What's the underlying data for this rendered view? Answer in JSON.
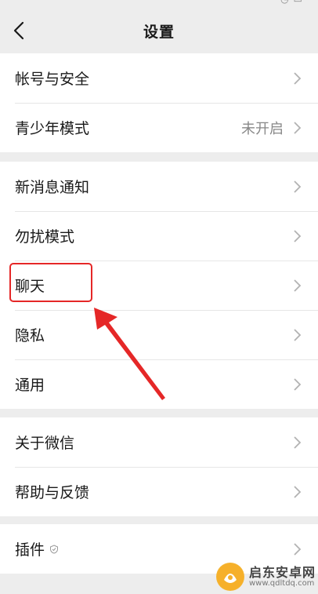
{
  "header": {
    "title": "设置"
  },
  "groups": [
    {
      "items": [
        {
          "label": "帐号与安全",
          "value": ""
        },
        {
          "label": "青少年模式",
          "value": "未开启"
        }
      ]
    },
    {
      "items": [
        {
          "label": "新消息通知",
          "value": ""
        },
        {
          "label": "勿扰模式",
          "value": ""
        },
        {
          "label": "聊天",
          "value": ""
        },
        {
          "label": "隐私",
          "value": ""
        },
        {
          "label": "通用",
          "value": ""
        }
      ]
    },
    {
      "items": [
        {
          "label": "关于微信",
          "value": ""
        },
        {
          "label": "帮助与反馈",
          "value": ""
        }
      ]
    },
    {
      "items": [
        {
          "label": "插件",
          "value": ""
        }
      ]
    }
  ],
  "annotation": {
    "highlight_color": "#e52727",
    "target": "聊天"
  },
  "watermark": {
    "name": "启东安卓网",
    "url": "www.qdltdq.com"
  },
  "colors": {
    "background": "#ededed",
    "row_bg": "#ffffff",
    "text": "#191919",
    "secondary": "#888888"
  }
}
